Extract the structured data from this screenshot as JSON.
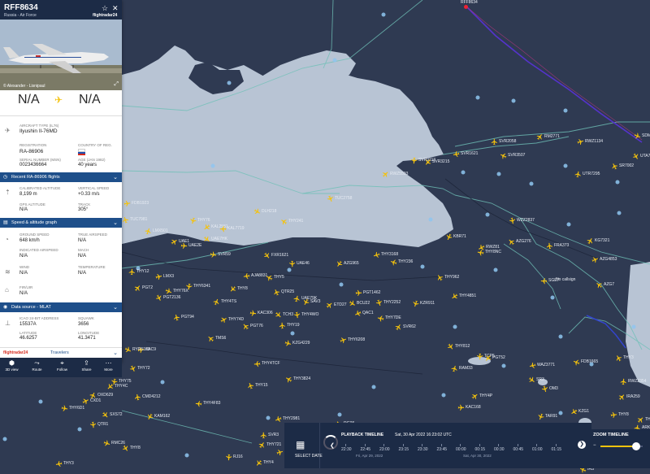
{
  "colors": {
    "sea": "#b8c4d4",
    "land": "#2f3a52",
    "panel_header": "#1e4f8a",
    "topbar": "#1c2b46",
    "plane": "#f4c20d",
    "track": "#5533cc"
  },
  "panel": {
    "callsign": "RFF8634",
    "operator": "Russia - Air Force",
    "brand": "flightradar24",
    "photo_credit": "© Alexander - Lisnipaul",
    "origin": "N/A",
    "destination": "N/A",
    "aircraft_type_label": "AIRCRAFT TYPE (IL76)",
    "aircraft_type": "Ilyushin Il-76MD",
    "registration_label": "REGISTRATION",
    "registration": "RA-86906",
    "country_label": "COUNTRY OF REG.",
    "serial_label": "SERIAL NUMBER (MSN)",
    "serial": "0023436664",
    "age_label": "AGE (JAN 1982)",
    "age": "40 years",
    "recent_flights": "Recent RA-86906 flights",
    "calibrated_alt_label": "CALIBRATED ALTITUDE",
    "calibrated_alt": "8,199 m",
    "vertical_speed_label": "VERTICAL SPEED",
    "vertical_speed": "+0.33 m/s",
    "gps_alt_label": "GPS ALTITUDE",
    "gps_alt": "N/A",
    "track_label": "TRACK",
    "track": "305°",
    "speed_section": "Speed & altitude graph",
    "ground_speed_label": "GROUND SPEED",
    "ground_speed": "648 km/h",
    "true_airspeed_label": "TRUE AIRSPEED",
    "true_airspeed": "N/A",
    "indicated_airspeed_label": "INDICATED AIRSPEED",
    "indicated_airspeed": "N/A",
    "mach_label": "MACH",
    "mach": "N/A",
    "wind_label": "WIND",
    "wind": "N/A",
    "temperature_label": "TEMPERATURE",
    "temperature": "N/A",
    "fir_label": "FIR/UIR",
    "fir": "N/A",
    "data_source": "Data source - MLAT",
    "icao_label": "ICAO 24-BIT ADDRESS",
    "icao": "15537A",
    "squawk_label": "SQUAWK",
    "squawk": "3656",
    "latitude_label": "LATITUDE",
    "latitude": "46.6257",
    "longitude_label": "LONGITUDE",
    "longitude": "41.3471",
    "travelers": "Travelers",
    "toolbar": [
      {
        "label": "3D view",
        "icon": "cube-icon"
      },
      {
        "label": "Route",
        "icon": "route-icon"
      },
      {
        "label": "Follow",
        "icon": "follow-icon"
      },
      {
        "label": "Share",
        "icon": "share-icon"
      },
      {
        "label": "More",
        "icon": "more-icon"
      }
    ]
  },
  "map": {
    "selected_label": "RFF8634",
    "no_callsign": "No callsign",
    "flights": [
      [
        "SVR2058",
        604,
        170
      ],
      [
        "RM2771",
        660,
        164
      ],
      [
        "RWZ1134",
        710,
        170
      ],
      [
        "SDM6254",
        780,
        163
      ],
      [
        "UTA7561",
        778,
        188
      ],
      [
        "SVR3113",
        505,
        193
      ],
      [
        "SVR3215",
        522,
        195
      ],
      [
        "SVR1621",
        557,
        185
      ],
      [
        "SVR3507",
        615,
        187
      ],
      [
        "SR7002",
        752,
        200
      ],
      [
        "UTR7295",
        707,
        210
      ],
      [
        "RWZ5593",
        470,
        210
      ],
      [
        "FDB1923",
        152,
        246
      ],
      [
        "DLH218",
        312,
        256
      ],
      [
        "TUC2758",
        402,
        240
      ],
      [
        "THY76",
        233,
        267
      ],
      [
        "KAL2581",
        250,
        275
      ],
      [
        "KAL7719",
        270,
        277
      ],
      [
        "THY241",
        345,
        268
      ],
      [
        "TUC7981",
        150,
        266
      ],
      [
        "LMX501",
        178,
        280
      ],
      [
        "UAE1",
        210,
        293
      ],
      [
        "UAE2E",
        222,
        298
      ],
      [
        "UAE7HK",
        250,
        290
      ],
      [
        "WZZ2837",
        626,
        267
      ],
      [
        "KBR71",
        548,
        287
      ],
      [
        "RWZ81",
        588,
        300
      ],
      [
        "THY8NC",
        587,
        306
      ],
      [
        "AZG276",
        625,
        293
      ],
      [
        "FRA373",
        672,
        298
      ],
      [
        "KG7321",
        722,
        292
      ],
      [
        "AZG4853",
        728,
        315
      ],
      [
        "SVR59",
        258,
        309
      ],
      [
        "FXR1621",
        324,
        310
      ],
      [
        "UAE46",
        355,
        320
      ],
      [
        "AZG965",
        413,
        320
      ],
      [
        "THY3168",
        459,
        309
      ],
      [
        "THY236",
        480,
        318
      ],
      [
        "THY962",
        537,
        337
      ],
      [
        "THY12",
        158,
        330
      ],
      [
        "PGT2",
        165,
        350
      ],
      [
        "LMX3",
        191,
        336
      ],
      [
        "THY76X",
        203,
        354
      ],
      [
        "PGT2136",
        191,
        362
      ],
      [
        "THY6341",
        228,
        348
      ],
      [
        "THY8",
        282,
        351
      ],
      [
        "AJA8831",
        299,
        335
      ],
      [
        "THY5",
        327,
        337
      ],
      [
        "QTR25",
        336,
        355
      ],
      [
        "UAE79K",
        361,
        363
      ],
      [
        "ETD27",
        401,
        371
      ],
      [
        "PGT1462",
        437,
        356
      ],
      [
        "BCU22",
        429,
        369
      ],
      [
        "THY2252",
        462,
        368
      ],
      [
        "KZR911",
        507,
        369
      ],
      [
        "THY4851",
        555,
        360
      ],
      [
        "SGE7",
        665,
        341
      ],
      [
        "AZG7",
        733,
        346
      ],
      [
        "PGT94",
        213,
        386
      ],
      [
        "THY4TS",
        262,
        367
      ],
      [
        "THY74D",
        271,
        389
      ],
      [
        "KAC306",
        307,
        381
      ],
      [
        "TCH3",
        338,
        383
      ],
      [
        "THY4WO",
        361,
        383
      ],
      [
        "SAV3",
        372,
        367
      ],
      [
        "QAC1",
        436,
        381
      ],
      [
        "THY7DE",
        464,
        387
      ],
      [
        "PGT76",
        298,
        397
      ],
      [
        "THY19",
        343,
        396
      ],
      [
        "SVR62",
        486,
        398
      ],
      [
        "THY6208",
        418,
        414
      ],
      [
        "KZG4229",
        350,
        418
      ],
      [
        "THY812",
        550,
        422
      ],
      [
        "TCP5",
        586,
        434
      ],
      [
        "PGT52",
        596,
        436
      ],
      [
        "WAZ3771",
        651,
        445
      ],
      [
        "FDB1665",
        705,
        441
      ],
      [
        "THY3",
        757,
        436
      ],
      [
        "RWZ2354",
        763,
        465
      ],
      [
        "IRA259",
        761,
        484
      ],
      [
        "KAC9",
        169,
        426
      ],
      [
        "RYR5100",
        153,
        426
      ],
      [
        "THY72",
        159,
        449
      ],
      [
        "THY75",
        136,
        465
      ],
      [
        "THY4C",
        131,
        471
      ],
      [
        "THY4TCF",
        312,
        443
      ],
      [
        "THY3824",
        351,
        462
      ],
      [
        "THY15",
        304,
        470
      ],
      [
        "RAM33",
        555,
        449
      ],
      [
        "THY4P",
        580,
        483
      ],
      [
        "KAC168",
        563,
        497
      ],
      [
        "SR3",
        650,
        463
      ],
      [
        "OM3",
        666,
        474
      ],
      [
        "TAR91",
        661,
        508
      ],
      [
        "KZG1",
        702,
        502
      ],
      [
        "THY4F83",
        240,
        492
      ],
      [
        "TMS6",
        255,
        412
      ],
      [
        "CMD4212",
        165,
        484
      ],
      [
        "OXD629",
        110,
        482
      ],
      [
        "CXD1",
        101,
        489
      ],
      [
        "THY6D1",
        75,
        498
      ],
      [
        "SXS72",
        125,
        506
      ],
      [
        "QTR1",
        110,
        518
      ],
      [
        "KAM162",
        180,
        508
      ],
      [
        "THY2981",
        338,
        511
      ],
      [
        "THY27",
        353,
        522
      ],
      [
        "RGT6",
        413,
        517
      ],
      [
        "SVR3",
        320,
        531
      ],
      [
        "THY721",
        318,
        543
      ],
      [
        "THY13",
        340,
        552
      ],
      [
        "RMC26",
        127,
        541
      ],
      [
        "THY8",
        150,
        547
      ],
      [
        "RJ16",
        277,
        558
      ],
      [
        "THY4",
        314,
        565
      ],
      [
        "THY3",
        68,
        566
      ],
      [
        "IRB",
        713,
        573
      ],
      [
        "THY10",
        760,
        534
      ],
      [
        "ARK6",
        780,
        522
      ],
      [
        "THY9",
        784,
        512
      ],
      [
        "THY8",
        751,
        506
      ]
    ]
  },
  "playback": {
    "select_date": "SELECT DATE",
    "title": "PLAYBACK TIMELINE",
    "datetime": "Sat, 30 Apr 2022 16:23:02 UTC",
    "ticks": [
      "22:30",
      "22:45",
      "23:00",
      "23:15",
      "23:30",
      "23:45",
      "00:00",
      "00:15",
      "00:30",
      "00:45",
      "01:00",
      "01:15"
    ],
    "date_left": "Fri, Apr 29, 2022",
    "date_right": "Sat, Apr 30, 2022"
  },
  "zoom": {
    "title": "ZOOM TIMELINE",
    "level": 0.85
  }
}
